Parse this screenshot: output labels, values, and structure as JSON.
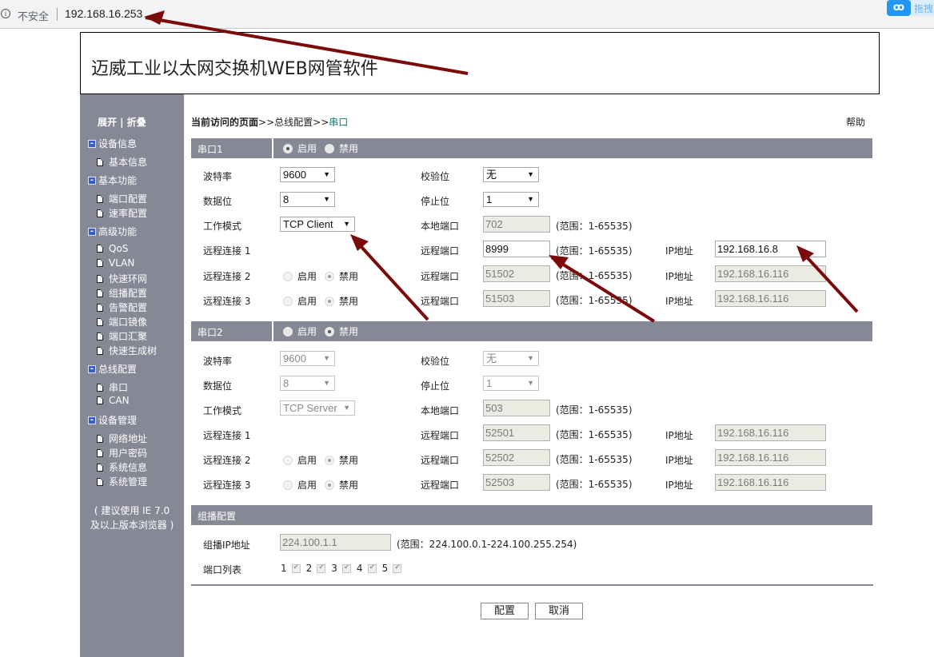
{
  "browser": {
    "security_label": "不安全",
    "url": "192.168.16.253",
    "extension_label": "拖拽"
  },
  "header": {
    "title": "迈威工业以太网交换机WEB网管软件"
  },
  "sidebar": {
    "toggle": "展开 | 折叠",
    "groups": [
      {
        "label": "设备信息",
        "items": [
          "基本信息"
        ]
      },
      {
        "label": "基本功能",
        "items": [
          "端口配置",
          "速率配置"
        ]
      },
      {
        "label": "高级功能",
        "items": [
          "QoS",
          "VLAN",
          "快速环网",
          "组播配置",
          "告警配置",
          "端口镜像",
          "端口汇聚",
          "快速生成树"
        ]
      },
      {
        "label": "总线配置",
        "items": [
          "串口",
          "CAN"
        ]
      },
      {
        "label": "设备管理",
        "items": [
          "网络地址",
          "用户密码",
          "系统信息",
          "系统管理"
        ]
      }
    ],
    "note_line1": "( 建议使用 IE 7.0",
    "note_line2": "及以上版本浏览器 )"
  },
  "breadcrumb": {
    "prefix": "当前访问的页面",
    "sep": ">>",
    "parent": "总线配置",
    "current": "串口"
  },
  "help_link": "帮助",
  "labels": {
    "enable": "启用",
    "disable": "禁用",
    "baud": "波特率",
    "parity": "校验位",
    "databits": "数据位",
    "stopbits": "停止位",
    "mode": "工作模式",
    "local_port": "本地端口",
    "remote_port": "远程端口",
    "ip": "IP地址",
    "range_port": "(范围：1-65535)",
    "remote1": "远程连接 1",
    "remote2": "远程连接 2",
    "remote3": "远程连接 3"
  },
  "serial1": {
    "title": "串口1",
    "state": "enabled",
    "baud": "9600",
    "parity": "无",
    "databits": "8",
    "stopbits": "1",
    "mode": "TCP Client",
    "local_port": "702",
    "remote": [
      {
        "port": "8999",
        "ip": "192.168.16.8",
        "state": null
      },
      {
        "port": "51502",
        "ip": "192.168.16.116",
        "state": "disabled"
      },
      {
        "port": "51503",
        "ip": "192.168.16.116",
        "state": "disabled"
      }
    ]
  },
  "serial2": {
    "title": "串口2",
    "state": "disabled",
    "baud": "9600",
    "parity": "无",
    "databits": "8",
    "stopbits": "1",
    "mode": "TCP Server",
    "local_port": "503",
    "remote": [
      {
        "port": "52501",
        "ip": "192.168.16.116",
        "state": null
      },
      {
        "port": "52502",
        "ip": "192.168.16.116",
        "state": "disabled"
      },
      {
        "port": "52503",
        "ip": "192.168.16.116",
        "state": "disabled"
      }
    ]
  },
  "multicast": {
    "title": "组播配置",
    "ip_label": "组播IP地址",
    "ip_value": "224.100.1.1",
    "ip_range": "(范围：224.100.0.1-224.100.255.254)",
    "ports_label": "端口列表",
    "ports": [
      {
        "num": "1",
        "checked": true
      },
      {
        "num": "2",
        "checked": true
      },
      {
        "num": "3",
        "checked": true
      },
      {
        "num": "4",
        "checked": true
      },
      {
        "num": "5",
        "checked": true
      }
    ]
  },
  "buttons": {
    "apply": "配置",
    "cancel": "取消"
  },
  "annotation_color": "#7b0a0a"
}
